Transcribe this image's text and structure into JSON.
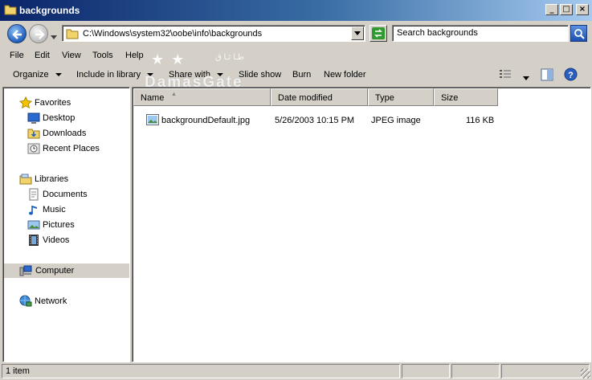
{
  "window": {
    "title": "backgrounds"
  },
  "address": {
    "path": "C:\\Windows\\system32\\oobe\\info\\backgrounds",
    "search_placeholder": "Search backgrounds"
  },
  "menu": [
    "File",
    "Edit",
    "View",
    "Tools",
    "Help"
  ],
  "toolbar": {
    "organize": "Organize",
    "include_in_library": "Include in library",
    "share_with": "Share with",
    "slide_show": "Slide show",
    "burn": "Burn",
    "new_folder": "New folder"
  },
  "watermark": {
    "stars": "★ ★",
    "arabic": "طـا ئـا ق",
    "brand": "DamasGate"
  },
  "nav": {
    "favorites": "Favorites",
    "desktop": "Desktop",
    "downloads": "Downloads",
    "recent_places": "Recent Places",
    "libraries": "Libraries",
    "documents": "Documents",
    "music": "Music",
    "pictures": "Pictures",
    "videos": "Videos",
    "computer": "Computer",
    "network": "Network"
  },
  "columns": {
    "name": "Name",
    "date_modified": "Date modified",
    "type": "Type",
    "size": "Size"
  },
  "files": [
    {
      "name": "backgroundDefault.jpg",
      "date_modified": "5/26/2003 10:15 PM",
      "type": "JPEG image",
      "size": "116 KB"
    }
  ],
  "status": {
    "item_count": "1 item"
  },
  "colors": {
    "title_start": "#0a246a",
    "title_end": "#a6caf0",
    "chrome": "#d4d0c8"
  },
  "icons": {
    "window": "folder-icon",
    "back": "back-arrow-icon",
    "forward": "forward-arrow-icon",
    "refresh": "refresh-icon",
    "search": "search-icon",
    "help": "help-icon"
  }
}
